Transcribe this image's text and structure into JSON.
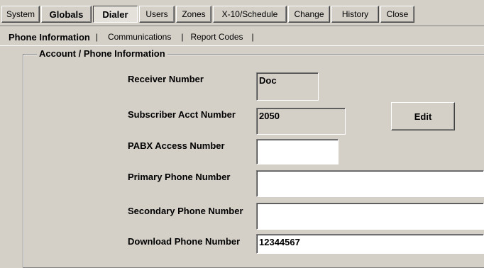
{
  "menu": {
    "items": [
      {
        "label": "System"
      },
      {
        "label": "Globals"
      },
      {
        "label": "Dialer"
      },
      {
        "label": "Users"
      },
      {
        "label": "Zones"
      },
      {
        "label": "X-10/Schedule"
      },
      {
        "label": "Change"
      },
      {
        "label": "History"
      },
      {
        "label": "Close"
      }
    ]
  },
  "subtabs": {
    "items": [
      {
        "label": "Phone Information"
      },
      {
        "label": "Communications"
      },
      {
        "label": "Report Codes"
      }
    ],
    "separator": "|"
  },
  "group": {
    "title": "Account / Phone Information"
  },
  "fields": {
    "receiver_number": {
      "label": "Receiver Number",
      "value": "Doc"
    },
    "subscriber_acct_number": {
      "label": "Subscriber Acct Number",
      "value": "2050"
    },
    "pabx_access_number": {
      "label": "PABX Access Number",
      "value": ""
    },
    "primary_phone_number": {
      "label": "Primary Phone Number",
      "value": ""
    },
    "secondary_phone_number": {
      "label": "Secondary Phone Number",
      "value": ""
    },
    "download_phone_number": {
      "label": "Download Phone Number",
      "value": "12344567"
    }
  },
  "buttons": {
    "edit_label": "Edit"
  }
}
